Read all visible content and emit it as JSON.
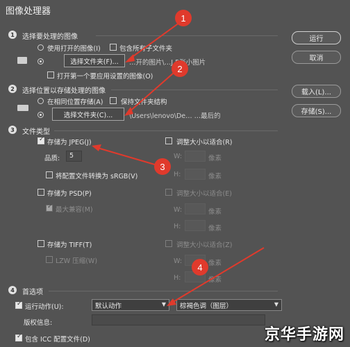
{
  "window": {
    "title": "图像处理器"
  },
  "sections": {
    "s1": {
      "number": "1",
      "label": "选择要处理的图像",
      "opt_use_open": "使用打开的图像(I)",
      "opt_include_sub": "包含所有子文件夹",
      "select_folder_btn": "选择文件夹(F)...",
      "path_text": "…开的图片\\…J 5张小图片",
      "opt_open_first": "打开第一个要应用设置的图像(O)"
    },
    "s2": {
      "number": "2",
      "label": "选择位置以存储处理的图像",
      "opt_same_location": "在相同位置存储(A)",
      "opt_keep_structure": "保持文件夹结构",
      "select_folder_btn": "选择文件夹(C)...",
      "path_text": "\\Users\\lenovo\\De…  …最后的"
    },
    "s3": {
      "number": "3",
      "label": "文件类型",
      "save_jpeg": "存储为 JPEG(J)",
      "resize_jpeg": "调整大小以适合(R)",
      "quality_label": "品质:",
      "quality_value": "5",
      "convert_srgb": "将配置文件转换为 sRGB(V)",
      "w_label": "W:",
      "h_label": "H:",
      "px_unit": "像素",
      "save_psd": "存储为 PSD(P)",
      "resize_psd": "调整大小以适合(E)",
      "max_compat": "最大兼容(M)",
      "save_tiff": "存储为 TIFF(T)",
      "resize_tiff": "调整大小以适合(Z)",
      "lzw": "LZW 压缩(W)"
    },
    "s4": {
      "number": "4",
      "label": "首选项",
      "run_action": "运行动作(U):",
      "action_set": "默认动作",
      "action_name": "棕褐色调（图层）",
      "copyright": "版权信息:",
      "include_icc": "包含 ICC 配置文件(D)"
    }
  },
  "buttons": {
    "run": "运行",
    "cancel": "取消",
    "load": "载入(L)...",
    "save": "存储(S)..."
  },
  "callouts": [
    "1",
    "2",
    "3",
    "4"
  ],
  "watermark": "京华手游网",
  "colors": {
    "callout": "#e03a2c",
    "dialog_bg": "#535353"
  }
}
